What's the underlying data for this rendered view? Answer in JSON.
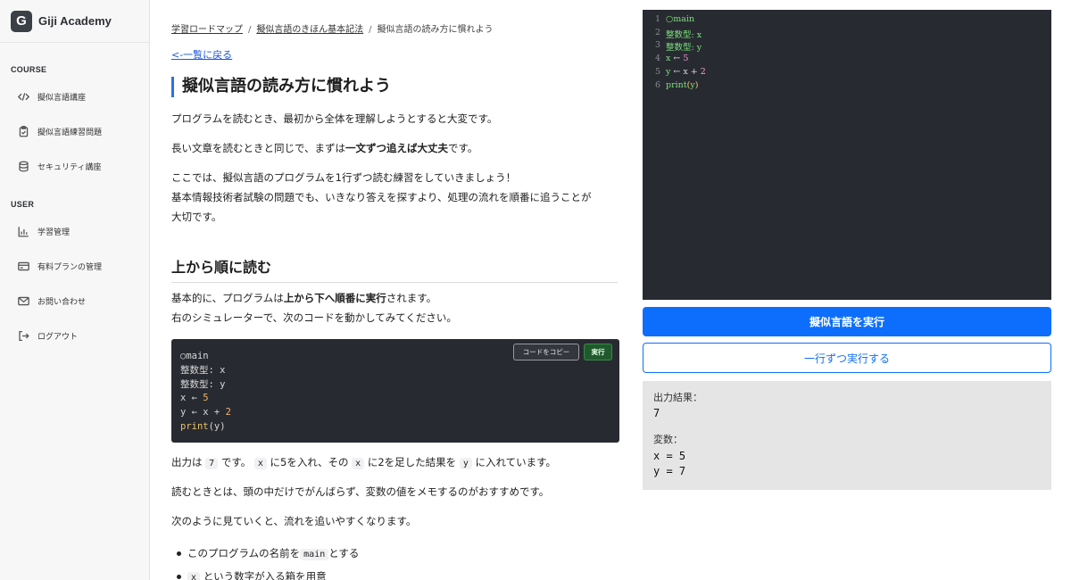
{
  "brand": {
    "logo_letter": "G",
    "name": "Giji Academy"
  },
  "sidebar": {
    "course_label": "COURSE",
    "course_items": [
      {
        "icon": "code-icon",
        "label": "擬似言語講座"
      },
      {
        "icon": "clipboard-icon",
        "label": "擬似言語練習問題"
      },
      {
        "icon": "database-icon",
        "label": "セキュリティ講座"
      }
    ],
    "user_label": "USER",
    "user_items": [
      {
        "icon": "chart-icon",
        "label": "学習管理"
      },
      {
        "icon": "credit-card-icon",
        "label": "有料プランの管理"
      },
      {
        "icon": "mail-icon",
        "label": "お問い合わせ"
      },
      {
        "icon": "logout-icon",
        "label": "ログアウト"
      }
    ]
  },
  "breadcrumb": {
    "items": [
      "学習ロードマップ",
      "擬似言語のきほん基本記法",
      "擬似言語の読み方に慣れよう"
    ],
    "separator": "/"
  },
  "back_link": "<-一覧に戻る",
  "page_title": "擬似言語の読み方に慣れよう",
  "intro": {
    "p1": "プログラムを読むとき、最初から全体を理解しようとすると大変です。",
    "p2_before": "長い文章を読むときと同じで、まずは",
    "p2_bold": "一文ずつ追えば大丈夫",
    "p2_after": "です。",
    "p3_line1": "ここでは、擬似言語のプログラムを1行ずつ読む練習をしていきましょう！",
    "p3_line2": "基本情報技術者試験の問題でも、いきなり答えを探すより、処理の流れを順番に追うことが",
    "p3_line3": "大切です。"
  },
  "section": {
    "heading": "上から順に読む",
    "p1_before": "基本的に、プログラムは",
    "p1_bold": "上から下へ順番に実行",
    "p1_after": "されます。",
    "p2": "右のシミュレーターで、次のコードを動かしてみてください。"
  },
  "code_block": {
    "copy_label": "コードをコピー",
    "run_label": "実行",
    "lines": {
      "l1": "○main",
      "l2": "整数型: x",
      "l3": "整数型: y",
      "l4_prefix": "x ← ",
      "l4_num": "5",
      "l5_prefix": "y ← x + ",
      "l5_num": "2",
      "l6_fn": "print",
      "l6_rest": "(y)"
    }
  },
  "explanation": {
    "a": "出力は",
    "code_7": "7",
    "b": "です。",
    "code_x1": "x",
    "c": "に5を入れ、その",
    "code_x2": "x",
    "d": "に2を足した結果を",
    "code_y": "y",
    "e": "に入れています。"
  },
  "tip": "読むときとは、頭の中だけでがんばらず、変数の値をメモするのがおすすめです。",
  "follow": "次のように見ていくと、流れを追いやすくなります。",
  "list": {
    "item1_before": "このプログラムの名前を",
    "item1_code": "main",
    "item1_after": "とする",
    "item2_code": "x",
    "item2_after": "という数字が入る箱を用意"
  },
  "editor": {
    "lines": [
      {
        "num": "1",
        "text": "○main"
      },
      {
        "num": "2",
        "text": "整数型: x"
      },
      {
        "num": "3",
        "text": "整数型: y"
      },
      {
        "num": "4",
        "var": "x",
        "arrow": " ← ",
        "value": "5"
      },
      {
        "num": "5",
        "var": "y",
        "arrow": " ← x + ",
        "value": "2"
      },
      {
        "num": "6",
        "fn": "print",
        "lp": "(",
        "arg": "y",
        "rp": ")"
      }
    ]
  },
  "buttons": {
    "execute": "擬似言語を実行",
    "step": "一行ずつ実行する"
  },
  "output": {
    "result_label": "出力結果：",
    "result_value": "7",
    "vars_label": "変数：",
    "vars": [
      "x = 5",
      "y = 7"
    ]
  },
  "colors": {
    "accent": "#0d6efd",
    "editor_bg": "#282a31",
    "heading_bar": "#2f6fdf"
  }
}
